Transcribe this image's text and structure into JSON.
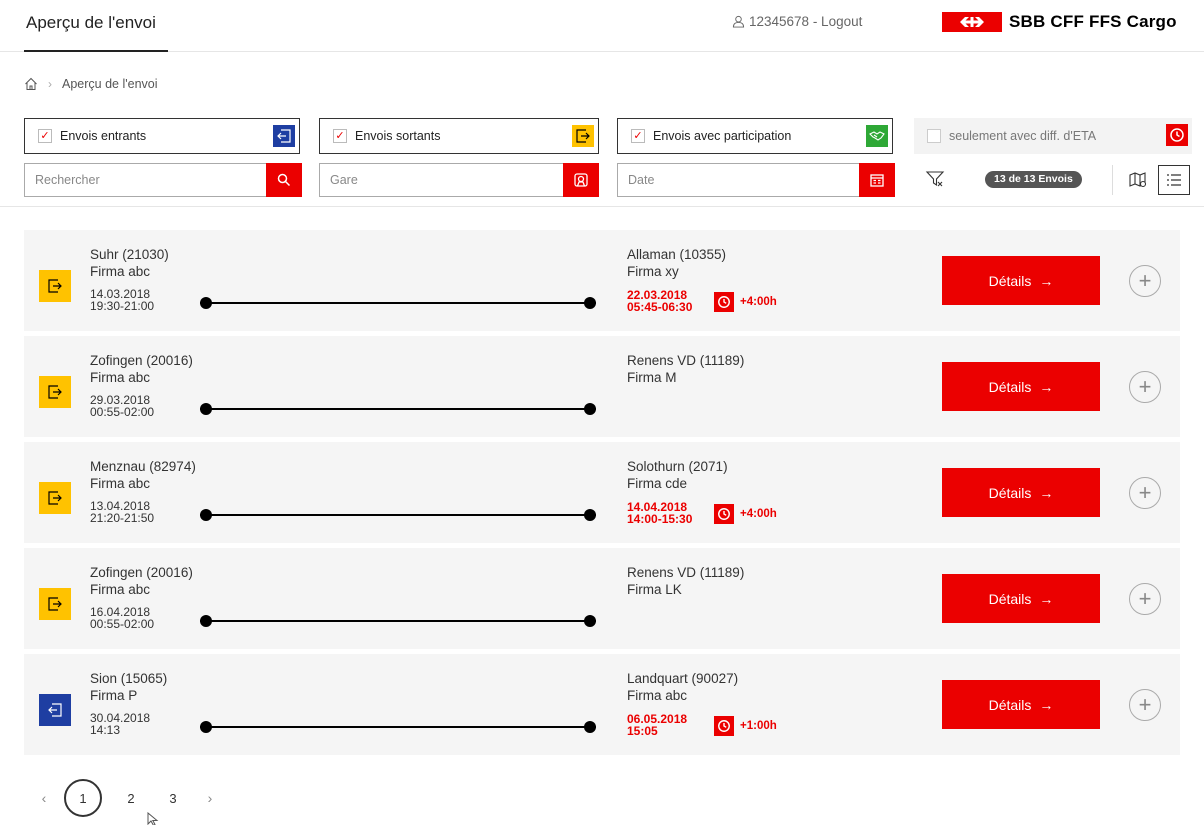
{
  "header": {
    "title": "Aperçu de l'envoi",
    "user": "12345678 - Logout",
    "logo_text": "SBB CFF FFS Cargo"
  },
  "breadcrumb": {
    "current": "Aperçu de l'envoi"
  },
  "filters": {
    "incoming": {
      "label": "Envois entrants",
      "checked": true,
      "icon": "arrow-in-icon",
      "color": "#1e3ea2"
    },
    "outgoing": {
      "label": "Envois sortants",
      "checked": true,
      "icon": "arrow-out-icon",
      "color": "#ffc200"
    },
    "participation": {
      "label": "Envois avec participation",
      "checked": true,
      "icon": "handshake-icon",
      "color": "#2ea836"
    },
    "eta_only": {
      "label": "seulement avec diff. d'ETA",
      "checked": false,
      "icon": "clock-icon",
      "color": "#eb0000"
    }
  },
  "search": {
    "query_placeholder": "Rechercher",
    "station_placeholder": "Gare",
    "date_placeholder": "Date"
  },
  "count_label": "13 de 13 Envois",
  "colors": {
    "accent": "#eb0000",
    "outgoing": "#ffc200",
    "incoming": "#1e3ea2"
  },
  "shipments": [
    {
      "direction": "out",
      "from_station": "Suhr (21030)",
      "from_company": "Firma abc",
      "from_date": "14.03.2018",
      "from_time": "19:30-21:00",
      "to_station": "Allaman (10355)",
      "to_company": "Firma xy",
      "eta_date": "22.03.2018",
      "eta_time": "05:45-06:30",
      "eta_diff": "+4:00h",
      "details_label": "Détails"
    },
    {
      "direction": "out",
      "from_station": "Zofingen (20016)",
      "from_company": "Firma abc",
      "from_date": "29.03.2018",
      "from_time": "00:55-02:00",
      "to_station": "Renens VD (11189)",
      "to_company": "Firma M",
      "eta_date": "",
      "eta_time": "",
      "eta_diff": "",
      "details_label": "Détails"
    },
    {
      "direction": "out",
      "from_station": "Menznau (82974)",
      "from_company": "Firma abc",
      "from_date": "13.04.2018",
      "from_time": "21:20-21:50",
      "to_station": "Solothurn (2071)",
      "to_company": "Firma cde",
      "eta_date": "14.04.2018",
      "eta_time": "14:00-15:30",
      "eta_diff": "+4:00h",
      "details_label": "Détails"
    },
    {
      "direction": "out",
      "from_station": "Zofingen (20016)",
      "from_company": "Firma abc",
      "from_date": "16.04.2018",
      "from_time": "00:55-02:00",
      "to_station": "Renens VD (11189)",
      "to_company": "Firma LK",
      "eta_date": "",
      "eta_time": "",
      "eta_diff": "",
      "details_label": "Détails"
    },
    {
      "direction": "in",
      "from_station": "Sion (15065)",
      "from_company": "Firma P",
      "from_date": "30.04.2018",
      "from_time": "14:13",
      "to_station": "Landquart (90027)",
      "to_company": "Firma abc",
      "eta_date": "06.05.2018",
      "eta_time": "15:05",
      "eta_diff": "+1:00h",
      "details_label": "Détails"
    }
  ],
  "pagination": {
    "prev": "‹",
    "current": "1",
    "pages": [
      "2",
      "3"
    ],
    "next": "›"
  }
}
